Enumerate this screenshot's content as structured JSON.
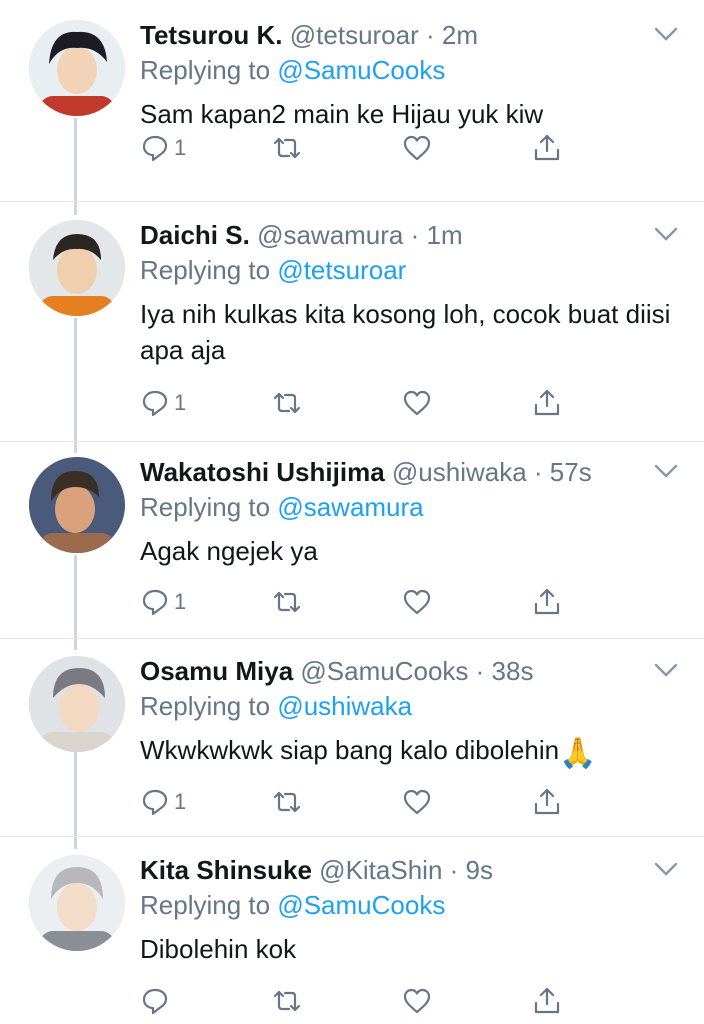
{
  "tweets": [
    {
      "name": "Tetsurou K.",
      "handle": "@tetsuroar",
      "time": "2m",
      "replying_label": "Replying to",
      "replying_to": "@SamuCooks",
      "text": "Sam kapan2 main ke Hijau yuk kiw",
      "reply_count": "1",
      "avatar_hair": "#1c1c24",
      "avatar_shirt": "#c0392b"
    },
    {
      "name": "Daichi S.",
      "handle": "@sawamura",
      "time": "1m",
      "replying_label": "Replying to",
      "replying_to": "@tetsuroar",
      "text": "Iya nih kulkas kita kosong loh, cocok buat diisi apa aja",
      "reply_count": "1",
      "avatar_hair": "#2b2622",
      "avatar_shirt": "#e67e22"
    },
    {
      "name": "Wakatoshi Ushijima",
      "handle": "@ushiwaka",
      "time": "57s",
      "replying_label": "Replying to",
      "replying_to": "@sawamura",
      "text": "Agak ngejek ya",
      "reply_count": "1",
      "avatar_hair": "#3a2e25",
      "avatar_shirt": "#9c6b4e"
    },
    {
      "name": "Osamu Miya",
      "handle": "@SamuCooks",
      "time": "38s",
      "replying_label": "Replying to",
      "replying_to": "@ushiwaka",
      "text": "Wkwkwkwk siap bang kalo dibolehin",
      "emoji": "🙏",
      "reply_count": "1",
      "avatar_hair": "#7a7a80",
      "avatar_shirt": "#d9d4cc"
    },
    {
      "name": "Kita Shinsuke",
      "handle": "@KitaShin",
      "time": "9s",
      "replying_label": "Replying to",
      "replying_to": "@SamuCooks",
      "text": "Dibolehin kok",
      "reply_count": "",
      "avatar_hair": "#b8b8bc",
      "avatar_shirt": "#8a8f96"
    }
  ],
  "icons": {
    "reply": "reply-icon",
    "retweet": "retweet-icon",
    "like": "like-icon",
    "share": "share-icon",
    "more": "chevron-down-icon"
  },
  "colors": {
    "link": "#1da1f2",
    "secondary_text": "#657786",
    "thread_line": "#ccd6dd"
  }
}
